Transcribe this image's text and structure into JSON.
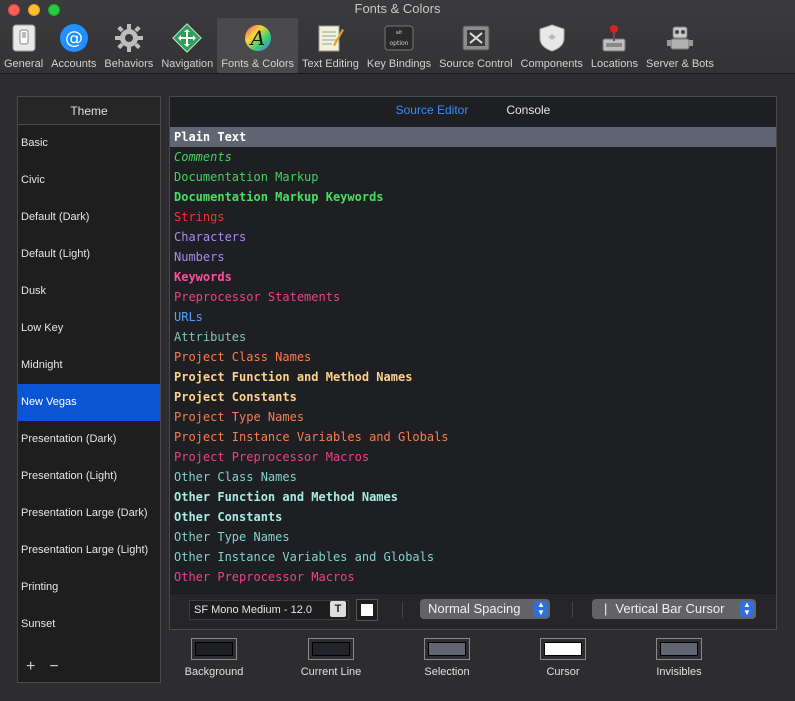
{
  "window": {
    "title": "Fonts & Colors"
  },
  "toolbar": [
    {
      "label": "General",
      "icon": "switch-icon"
    },
    {
      "label": "Accounts",
      "icon": "at-icon"
    },
    {
      "label": "Behaviors",
      "icon": "gear-icon"
    },
    {
      "label": "Navigation",
      "icon": "move-arrows-icon"
    },
    {
      "label": "Fonts & Colors",
      "icon": "color-font-icon",
      "active": true
    },
    {
      "label": "Text Editing",
      "icon": "notepad-icon"
    },
    {
      "label": "Key Bindings",
      "icon": "option-key-icon"
    },
    {
      "label": "Source Control",
      "icon": "source-control-icon"
    },
    {
      "label": "Components",
      "icon": "shield-icon"
    },
    {
      "label": "Locations",
      "icon": "joystick-icon"
    },
    {
      "label": "Server & Bots",
      "icon": "robot-icon"
    }
  ],
  "theme": {
    "header": "Theme",
    "items": [
      "Basic",
      "Civic",
      "Default (Dark)",
      "Default (Light)",
      "Dusk",
      "Low Key",
      "Midnight",
      "New Vegas",
      "Presentation (Dark)",
      "Presentation (Light)",
      "Presentation Large (Dark)",
      "Presentation Large (Light)",
      "Printing",
      "Sunset"
    ],
    "selected": "New Vegas",
    "add_label": "+",
    "remove_label": "−"
  },
  "editor": {
    "tabs": [
      {
        "label": "Source Editor",
        "active": true
      },
      {
        "label": "Console",
        "active": false
      }
    ],
    "syntax": [
      {
        "label": "Plain Text",
        "color": "#ffffff",
        "bold": true,
        "selected": true
      },
      {
        "label": "Comments",
        "color": "#3fd45a",
        "italic": true
      },
      {
        "label": "Documentation Markup",
        "color": "#3fd45a"
      },
      {
        "label": "Documentation Markup Keywords",
        "color": "#45e060",
        "bold": true
      },
      {
        "label": "Strings",
        "color": "#f2382c"
      },
      {
        "label": "Characters",
        "color": "#a98af0"
      },
      {
        "label": "Numbers",
        "color": "#a98af0"
      },
      {
        "label": "Keywords",
        "color": "#ff4fa0",
        "bold": true
      },
      {
        "label": "Preprocessor Statements",
        "color": "#f43f86"
      },
      {
        "label": "URLs",
        "color": "#4aa4ff"
      },
      {
        "label": "Attributes",
        "color": "#7fc8a8"
      },
      {
        "label": "Project Class Names",
        "color": "#ff7b4a"
      },
      {
        "label": "Project Function and Method Names",
        "color": "#ffd28a",
        "bold": true
      },
      {
        "label": "Project Constants",
        "color": "#ffd28a",
        "bold": true
      },
      {
        "label": "Project Type Names",
        "color": "#ff7b4a"
      },
      {
        "label": "Project Instance Variables and Globals",
        "color": "#ff7b4a"
      },
      {
        "label": "Project Preprocessor Macros",
        "color": "#f43f86"
      },
      {
        "label": "Other Class Names",
        "color": "#7fd6c4"
      },
      {
        "label": "Other Function and Method Names",
        "color": "#a4eedd",
        "bold": true
      },
      {
        "label": "Other Constants",
        "color": "#a4eedd",
        "bold": true
      },
      {
        "label": "Other Type Names",
        "color": "#7fd6c4"
      },
      {
        "label": "Other Instance Variables and Globals",
        "color": "#7fd6c4"
      },
      {
        "label": "Other Preprocessor Macros",
        "color": "#f43f86"
      }
    ],
    "font": "SF Mono Medium - 12.0",
    "font_button": "T",
    "spacing": "Normal Spacing",
    "cursor": "Vertical Bar Cursor",
    "cursor_glyph": "|"
  },
  "swatches": [
    {
      "label": "Background",
      "color": "#1e1f23"
    },
    {
      "label": "Current Line",
      "color": "#23242a"
    },
    {
      "label": "Selection",
      "color": "#5f6572"
    },
    {
      "label": "Cursor",
      "color": "#ffffff"
    },
    {
      "label": "Invisibles",
      "color": "#5f6572"
    }
  ]
}
